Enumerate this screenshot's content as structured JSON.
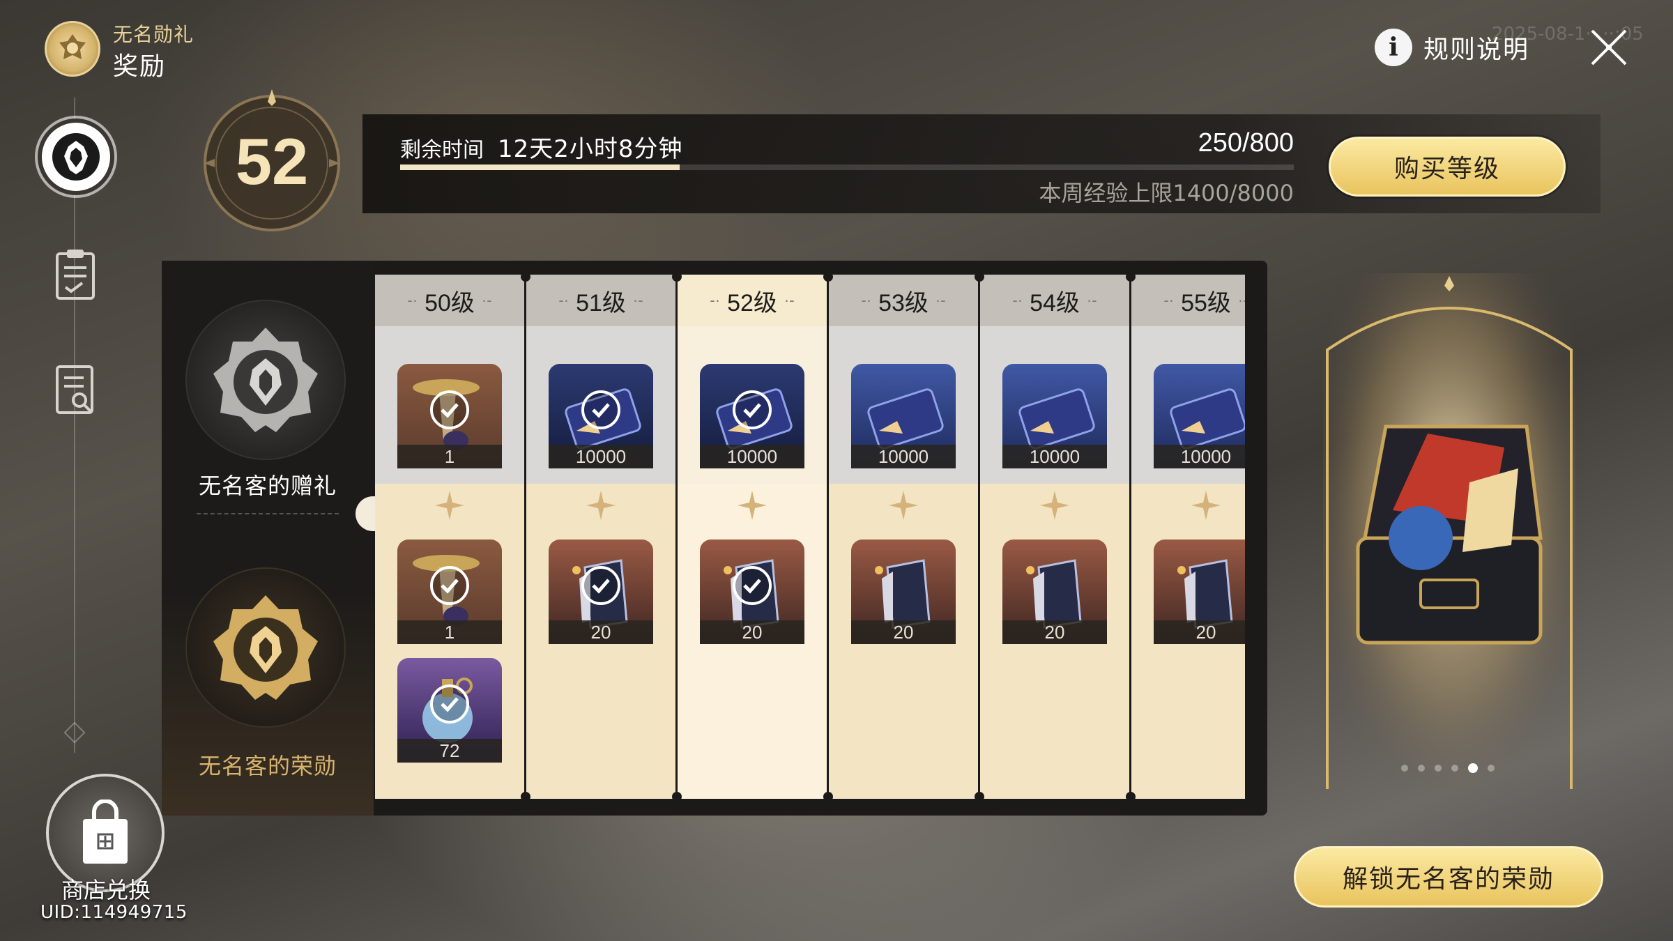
{
  "header": {
    "subtitle": "无名勋礼",
    "title": "奖励",
    "rules_label": "规则说明",
    "watermark": "2025-08-1·· ··:05"
  },
  "nav": {
    "shop_label": "商店兑换",
    "uid": "UID:114949715"
  },
  "level": {
    "current": "52",
    "time_label": "剩余时间",
    "time_remaining": "12天2小时8分钟",
    "exp_text": "250/800",
    "exp_progress": 0.3125,
    "weekly_cap": "本周经验上限1400/8000",
    "buy_button": "购买等级"
  },
  "tracks": {
    "free_label": "无名客的赠礼",
    "premium_label": "无名客的荣勋"
  },
  "columns": [
    {
      "level": "50级",
      "current": false,
      "free": [
        {
          "icon": "hourglass-icon",
          "count": "1",
          "claimed": true,
          "bg": "bg-brown"
        }
      ],
      "premium": [
        {
          "icon": "hourglass-icon",
          "count": "1",
          "claimed": true,
          "bg": "bg-brown"
        },
        {
          "icon": "potion-flask-icon",
          "count": "72",
          "claimed": true,
          "bg": "bg-purple"
        }
      ]
    },
    {
      "level": "51级",
      "current": false,
      "free": [
        {
          "icon": "pass-ticket-icon",
          "count": "10000",
          "claimed": true,
          "bg": "bg-navy"
        }
      ],
      "premium": [
        {
          "icon": "book-icon",
          "count": "20",
          "claimed": true,
          "bg": "bg-maroon"
        }
      ]
    },
    {
      "level": "52级",
      "current": true,
      "free": [
        {
          "icon": "pass-ticket-icon",
          "count": "10000",
          "claimed": true,
          "bg": "bg-navy"
        }
      ],
      "premium": [
        {
          "icon": "book-icon",
          "count": "20",
          "claimed": true,
          "bg": "bg-maroon"
        }
      ]
    },
    {
      "level": "53级",
      "current": false,
      "free": [
        {
          "icon": "pass-ticket-icon",
          "count": "10000",
          "claimed": false,
          "bg": "bg-blue"
        }
      ],
      "premium": [
        {
          "icon": "book-icon",
          "count": "20",
          "claimed": false,
          "bg": "bg-maroon"
        }
      ]
    },
    {
      "level": "54级",
      "current": false,
      "free": [
        {
          "icon": "pass-ticket-icon",
          "count": "10000",
          "claimed": false,
          "bg": "bg-blue"
        }
      ],
      "premium": [
        {
          "icon": "book-icon",
          "count": "20",
          "claimed": false,
          "bg": "bg-maroon"
        }
      ]
    },
    {
      "level": "55级",
      "current": false,
      "free": [
        {
          "icon": "pass-ticket-icon",
          "count": "10000",
          "claimed": false,
          "bg": "bg-blue"
        }
      ],
      "premium": [
        {
          "icon": "book-icon",
          "count": "20",
          "claimed": false,
          "bg": "bg-maroon"
        }
      ]
    }
  ],
  "showcase": {
    "page_count": 6,
    "active_page": 5,
    "unlock_button": "解锁无名客的荣勋"
  },
  "colors": {
    "gold": "#e9c45e",
    "gold_light": "#fbe9a2",
    "panel": "#1c1a18",
    "premium_bg": "#f3e4c4",
    "free_bg": "#d9d8d6"
  }
}
